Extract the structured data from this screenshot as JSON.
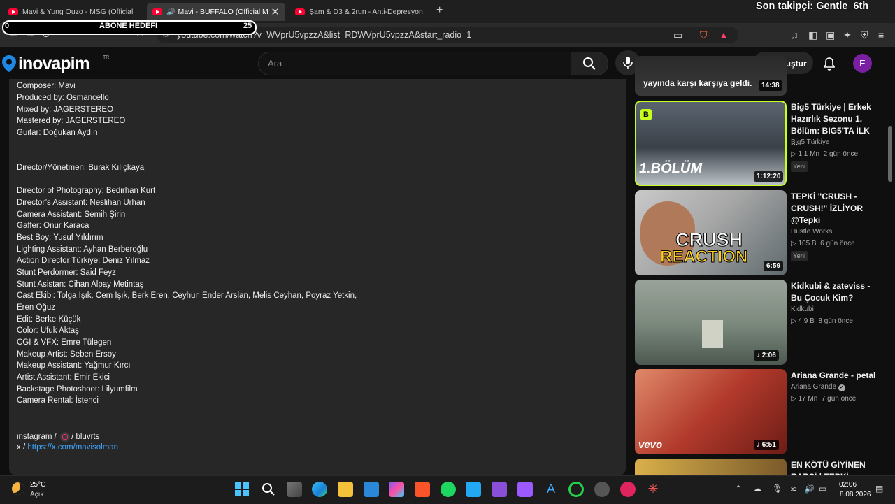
{
  "overlay": {
    "follower_text": "Son takipçi: Gentle_6th",
    "goal_label": "ABONE HEDEFİ",
    "goal_min": "0",
    "goal_max": "25"
  },
  "browser": {
    "tabs": [
      {
        "title": "Mavi & Yung Ouzo - MSG (Official V",
        "active": false
      },
      {
        "title": "Mavi - BUFFALO (Official Mus",
        "active": true,
        "audio": "🔊"
      },
      {
        "title": "Şam & D3 & 2run - Anti-Depresyon",
        "active": false
      }
    ],
    "close_glyph": "✕",
    "new_tab": "+",
    "url": "youtube.com/watch?v=WVprU5vpzzA&list=RDWVprU5vpzzA&start_radio=1"
  },
  "youtube": {
    "logo_text": "inovapim",
    "logo_tr": "TR",
    "search_placeholder": "Ara",
    "create_label": "Oluştur",
    "avatar_letter": "E"
  },
  "description": {
    "lines": [
      "Composer: Mavi",
      "Produced by: Osmancello",
      "Mixed by: JAGERSTEREO",
      "Mastered by: JAGERSTEREO",
      "Guitar: Doğukan Aydın",
      "Director/Yönetmen: Burak Kılıçkaya",
      "Director of Photography: Bedirhan Kurt",
      "Director’s Assistant: Neslihan Urhan",
      "Camera Assistant: Semih Şirin",
      "Gaffer: Onur Karaca",
      "Best Boy: Yusuf Yıldırım",
      "Lighting Assistant: Ayhan Berberoğlu",
      "Action Director Türkiye: Deniz Yılmaz",
      "Stunt Perdormer: Said Feyz",
      "Stunt Asistan: Cihan Alpay Metintaş",
      "Cast Ekibi: Tolga Işık, Cem Işık, Berk Eren, Ceyhun Ender Arslan, Melis Ceyhan, Poyraz Yetkin,",
      "Eren Oğuz",
      "Edit: Berke Küçük",
      "Color: Ufuk Aktaş",
      "CGI & VFX: Emre Tülegen",
      "Makeup Artist: Seben Ersoy",
      "Makeup Assistant: Yağmur Kırcı",
      "Artist Assistant: Emir Ekici",
      "Backstage Photoshoot: Lilyumfilm",
      "Camera Rental: İstenci"
    ],
    "instagram_prefix": "instagram /",
    "instagram_handle": "/ bluvrts",
    "x_prefix": "x /",
    "x_link": "https://x.com/mavisolman"
  },
  "sidebar": {
    "partial_title": "yayında karşı karşıya geldi.",
    "partial_duration": "14:38",
    "items": [
      {
        "title": "Big5 Türkiye | Erkek Hazırlık Sezonu 1. Bölüm: BIG5'TA İLK ...",
        "channel": "Big5 Türkiye",
        "views": "▷ 1,1 Mn",
        "age": "2 gün önce",
        "badge": "Yeni",
        "duration": "1:12:20",
        "thumb_text": "1.BÖLÜM",
        "corner": "B"
      },
      {
        "title": "TEPKİ \"CRUSH - CRUSH!\" İZLİYOR @Tepki",
        "channel": "Hustle Works",
        "views": "▷ 105 B",
        "age": "6 gün önce",
        "badge": "Yeni",
        "duration": "6:59",
        "thumb_text1": "CRUSH",
        "thumb_text2": "REACTION"
      },
      {
        "title": "Kidkubi & zateviss - Bu Çocuk Kim?",
        "channel": "Kidkubi",
        "views": "▷ 4,9 B",
        "age": "8 gün önce",
        "duration": "♪ 2:06"
      },
      {
        "title": "Ariana Grande - petal",
        "channel": "Ariana Grande",
        "verified": "✔",
        "views": "▷ 17 Mn",
        "age": "7 gün önce",
        "duration": "♪ 6:51",
        "thumb_text": "vevo"
      },
      {
        "title": "EN KÖTÜ GİYİNEN RAPÇİ | TEPKİ"
      }
    ]
  },
  "taskbar": {
    "temperature": "25°C",
    "condition": "Açık",
    "time": "02:06",
    "date": "8.08.2026"
  }
}
